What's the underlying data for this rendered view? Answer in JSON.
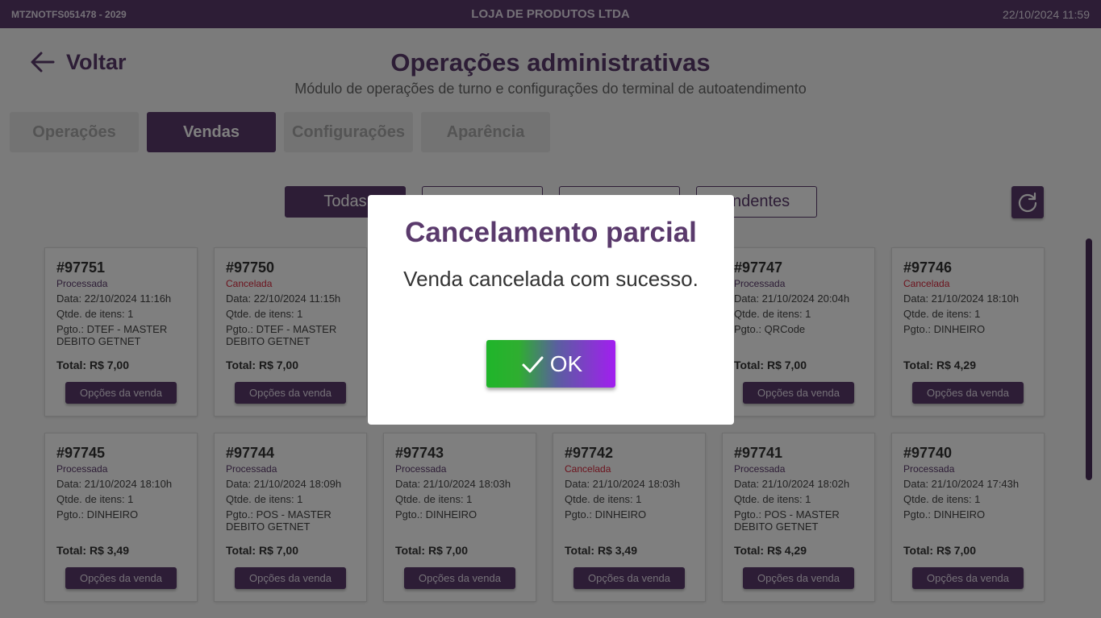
{
  "topbar": {
    "terminal": "MTZNOTFS051478 - 2029",
    "store": "LOJA DE PRODUTOS LTDA",
    "datetime": "22/10/2024 11:59"
  },
  "header": {
    "back_label": "Voltar",
    "title": "Operações administrativas",
    "subtitle": "Módulo de operações de turno e configurações do terminal de autoatendimento"
  },
  "tabs": [
    "Operações",
    "Vendas",
    "Configurações",
    "Aparência"
  ],
  "active_tab": "Vendas",
  "filters": [
    "Todas",
    "",
    "",
    "endentes"
  ],
  "sales": [
    {
      "num": "#97751",
      "status": "Processada",
      "date": "Data: 22/10/2024 11:16h",
      "qty": "Qtde. de itens: 1",
      "pay": "Pgto.: DTEF - MASTER DEBITO GETNET",
      "total": "Total: R$ 7,00",
      "btn": "Opções da venda"
    },
    {
      "num": "#97750",
      "status": "Cancelada",
      "date": "Data: 22/10/2024 11:15h",
      "qty": "Qtde. de itens: 1",
      "pay": "Pgto.: DTEF - MASTER DEBITO GETNET",
      "total": "Total: R$ 7,00",
      "btn": "Opções da venda"
    },
    {
      "num": "",
      "status": "",
      "date": "",
      "qty": "",
      "pay": "",
      "total": "",
      "btn": ""
    },
    {
      "num": "",
      "status": "",
      "date": "",
      "qty": "",
      "pay": "",
      "total": "",
      "btn": ""
    },
    {
      "num": "#97747",
      "status": "Processada",
      "date": "Data: 21/10/2024 20:04h",
      "qty": "Qtde. de itens: 1",
      "pay": "Pgto.: QRCode",
      "total": "Total: R$ 7,00",
      "btn": "Opções da venda"
    },
    {
      "num": "#97746",
      "status": "Cancelada",
      "date": "Data: 21/10/2024 18:10h",
      "qty": "Qtde. de itens: 1",
      "pay": "Pgto.: DINHEIRO",
      "total": "Total: R$ 4,29",
      "btn": "Opções da venda"
    },
    {
      "num": "#97745",
      "status": "Processada",
      "date": "Data: 21/10/2024 18:10h",
      "qty": "Qtde. de itens: 1",
      "pay": "Pgto.: DINHEIRO",
      "total": "Total: R$ 3,49",
      "btn": "Opções da venda"
    },
    {
      "num": "#97744",
      "status": "Processada",
      "date": "Data: 21/10/2024 18:09h",
      "qty": "Qtde. de itens: 1",
      "pay": "Pgto.: POS - MASTER DEBITO GETNET",
      "total": "Total: R$ 7,00",
      "btn": "Opções da venda"
    },
    {
      "num": "#97743",
      "status": "Processada",
      "date": "Data: 21/10/2024 18:03h",
      "qty": "Qtde. de itens: 1",
      "pay": "Pgto.: DINHEIRO",
      "total": "Total: R$ 7,00",
      "btn": "Opções da venda"
    },
    {
      "num": "#97742",
      "status": "Cancelada",
      "date": "Data: 21/10/2024 18:03h",
      "qty": "Qtde. de itens: 1",
      "pay": "Pgto.: DINHEIRO",
      "total": "Total: R$ 3,49",
      "btn": "Opções da venda"
    },
    {
      "num": "#97741",
      "status": "Processada",
      "date": "Data: 21/10/2024 18:02h",
      "qty": "Qtde. de itens: 1",
      "pay": "Pgto.: POS - MASTER DEBITO GETNET",
      "total": "Total: R$ 4,29",
      "btn": "Opções da venda"
    },
    {
      "num": "#97740",
      "status": "Processada",
      "date": "Data: 21/10/2024 17:43h",
      "qty": "Qtde. de itens: 1",
      "pay": "Pgto.: DINHEIRO",
      "total": "Total: R$ 7,00",
      "btn": "Opções da venda"
    }
  ],
  "modal": {
    "title": "Cancelamento parcial",
    "message": "Venda cancelada com sucesso.",
    "ok_label": "OK"
  },
  "colors": {
    "brand": "#5a3a6c",
    "cancel": "#d8263b",
    "ok_gradient_start": "#1fb52a",
    "ok_gradient_end": "#a21ef0"
  }
}
